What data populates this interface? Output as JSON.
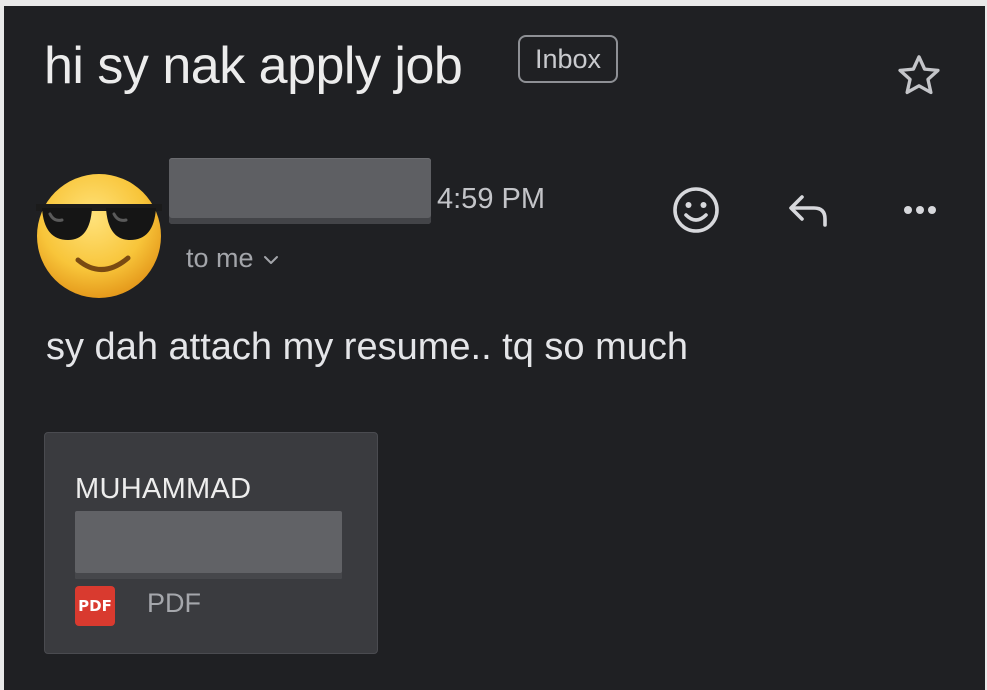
{
  "email": {
    "subject": "hi sy nak apply job",
    "label": "Inbox",
    "time": "4:59 PM",
    "recipient": "to me",
    "body": "sy dah attach my resume.. tq so much"
  },
  "attachment": {
    "name": "MUHAMMAD",
    "badge": "PDF",
    "type_label": "PDF"
  },
  "icons": {
    "star": "star-icon",
    "avatar": "sunglasses-emoji-avatar",
    "emoji": "add-reaction-icon",
    "reply": "reply-icon",
    "more": "more-horizontal-icon",
    "pdf": "pdf-file-icon"
  },
  "colors": {
    "background": "#1f2023",
    "attachment_card": "#3a3b3f",
    "pdf_badge": "#d93a2f",
    "redaction": "#5e5f63"
  }
}
